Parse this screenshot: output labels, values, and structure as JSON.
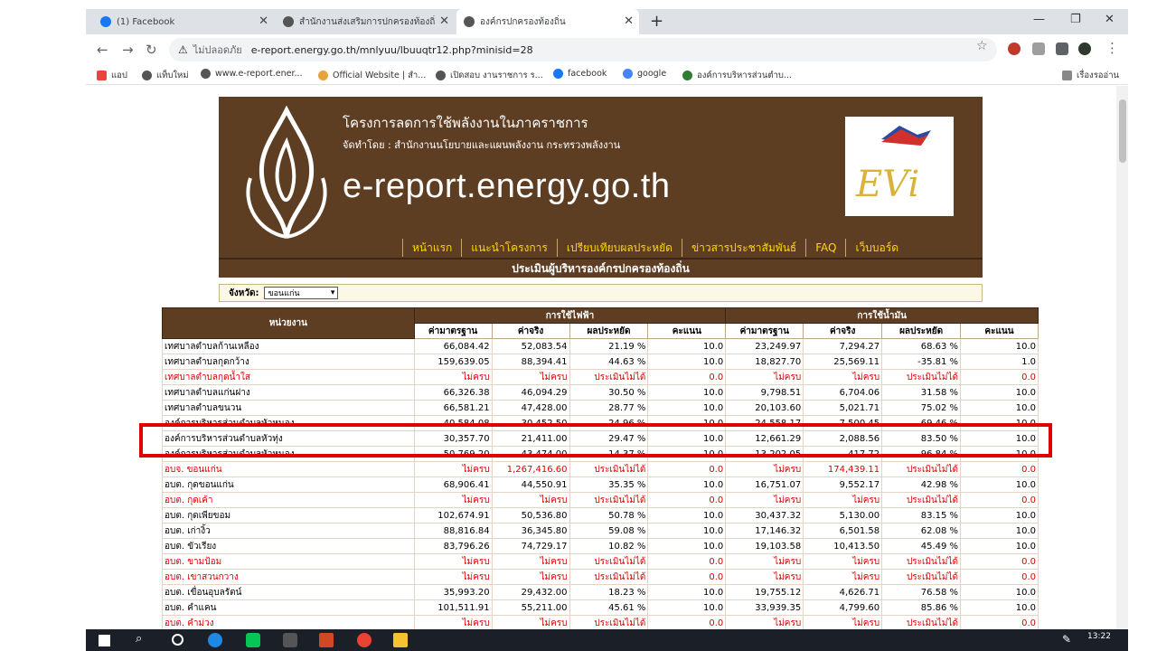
{
  "tabs": [
    {
      "label": "(1) Facebook",
      "color": "#1877f2"
    },
    {
      "label": "สำนักงานส่งเสริมการปกครองท้องถิ่นจั...",
      "color": "#555555"
    },
    {
      "label": "องค์กรปกครองท้องถิ่น",
      "color": "#555555"
    }
  ],
  "address": {
    "security": "ไม่ปลอดภัย",
    "url": "e-report.energy.go.th/mnlyuu/lbuuqtr12.php?minisid=28"
  },
  "bookmarks": [
    {
      "label": "แอป",
      "color": "#e8453c"
    },
    {
      "label": "แท็บใหม่",
      "color": "#555555"
    },
    {
      "label": "www.e-report.ener...",
      "color": "#555555"
    },
    {
      "label": "Official Website | สำ...",
      "color": "#e8a23c"
    },
    {
      "label": "เปิดสอบ งานราชการ ร...",
      "color": "#555555"
    },
    {
      "label": "facebook",
      "color": "#1877f2"
    },
    {
      "label": "google",
      "color": "#4285f4"
    },
    {
      "label": "องค์การบริหารส่วนตำบ...",
      "color": "#2e7d32"
    }
  ],
  "reading_list": "เรื่องรออ่าน",
  "banner": {
    "title": "โครงการลดการใช้พลังงานในภาคราชการ",
    "subtitle": "จัดทำโดย : สำนักงานนโยบายและแผนพลังงาน กระทรวงพลังงาน",
    "domain": "e-report.energy.go.th",
    "logo_text": "EVi",
    "menu": [
      "หน้าแรก",
      "แนะนำโครงการ",
      "เปรียบเทียบผลประหยัด",
      "ข่าวสารประชาสัมพันธ์",
      "FAQ",
      "เว็บบอร์ด"
    ]
  },
  "page_title": "ประเมินผู้บริหารองค์กรปกครองท้องถิ่น",
  "filter": {
    "label": "จังหวัด:",
    "value": "ขอนแก่น"
  },
  "table": {
    "unit_header": "หน่วยงาน",
    "group_electric": "การใช้ไฟฟ้า",
    "group_oil": "การใช้น้ำมัน",
    "sub_headers": [
      "ค่ามาตรฐาน",
      "ค่าจริง",
      "ผลประหยัด",
      "คะแนน",
      "ค่ามาตรฐาน",
      "ค่าจริง",
      "ผลประหยัด",
      "คะแนน"
    ],
    "rows": [
      {
        "name": "เทศบาลตำบลก้านเหลือง",
        "cells": [
          "66,084.42",
          "52,083.54",
          "21.19 %",
          "10.0",
          "23,249.97",
          "7,294.27",
          "68.63 %",
          "10.0"
        ],
        "red": false
      },
      {
        "name": "เทศบาลตำบลกุดกว้าง",
        "cells": [
          "159,639.05",
          "88,394.41",
          "44.63 %",
          "10.0",
          "18,827.70",
          "25,569.11",
          "-35.81 %",
          "1.0"
        ],
        "red": false
      },
      {
        "name": "เทศบาลตำบลกุดน้ำใส",
        "cells": [
          "ไม่ครบ",
          "ไม่ครบ",
          "ประเมินไม่ได้",
          "0.0",
          "ไม่ครบ",
          "ไม่ครบ",
          "ประเมินไม่ได้",
          "0.0"
        ],
        "red": true
      },
      {
        "name": "เทศบาลตำบลแก่นฝาง",
        "cells": [
          "66,326.38",
          "46,094.29",
          "30.50 %",
          "10.0",
          "9,798.51",
          "6,704.06",
          "31.58 %",
          "10.0"
        ],
        "red": false
      },
      {
        "name": "เทศบาลตำบลขนวน",
        "cells": [
          "66,581.21",
          "47,428.00",
          "28.77 %",
          "10.0",
          "20,103.60",
          "5,021.71",
          "75.02 %",
          "10.0"
        ],
        "red": false
      },
      {
        "name": "องค์การบริหารส่วนตำบลหัวหนอง",
        "cells": [
          "40,584.08",
          "30,452.50",
          "24.96 %",
          "10.0",
          "24,558.17",
          "7,500.45",
          "69.46 %",
          "10.0"
        ],
        "red": false
      },
      {
        "name": "องค์การบริหารส่วนตำบลหัวทุ่ง",
        "cells": [
          "30,357.70",
          "21,411.00",
          "29.47 %",
          "10.0",
          "12,661.29",
          "2,088.56",
          "83.50 %",
          "10.0"
        ],
        "red": false
      },
      {
        "name": "องค์การบริหารส่วนตำบลหัวหนอง",
        "cells": [
          "50,769.20",
          "43,474.00",
          "14.37 %",
          "10.0",
          "13,202.05",
          "417.72",
          "96.84 %",
          "10.0"
        ],
        "red": false
      },
      {
        "name": "อบจ. ขอนแก่น",
        "cells": [
          "ไม่ครบ",
          "1,267,416.60",
          "ประเมินไม่ได้",
          "0.0",
          "ไม่ครบ",
          "174,439.11",
          "ประเมินไม่ได้",
          "0.0"
        ],
        "red": true
      },
      {
        "name": "อบต. กุดขอนแก่น",
        "cells": [
          "68,906.41",
          "44,550.91",
          "35.35 %",
          "10.0",
          "16,751.07",
          "9,552.17",
          "42.98 %",
          "10.0"
        ],
        "red": false
      },
      {
        "name": "อบต. กุดเค้า",
        "cells": [
          "ไม่ครบ",
          "ไม่ครบ",
          "ประเมินไม่ได้",
          "0.0",
          "ไม่ครบ",
          "ไม่ครบ",
          "ประเมินไม่ได้",
          "0.0"
        ],
        "red": true
      },
      {
        "name": "อบต. กุดเพียขอม",
        "cells": [
          "102,674.91",
          "50,536.80",
          "50.78 %",
          "10.0",
          "30,437.32",
          "5,130.00",
          "83.15 %",
          "10.0"
        ],
        "red": false
      },
      {
        "name": "อบต. เก่างิ้ว",
        "cells": [
          "88,816.84",
          "36,345.80",
          "59.08 %",
          "10.0",
          "17,146.32",
          "6,501.58",
          "62.08 %",
          "10.0"
        ],
        "red": false
      },
      {
        "name": "อบต. ขัวเรียง",
        "cells": [
          "83,796.26",
          "74,729.17",
          "10.82 %",
          "10.0",
          "19,103.58",
          "10,413.50",
          "45.49 %",
          "10.0"
        ],
        "red": false
      },
      {
        "name": "อบต. ขามป้อม",
        "cells": [
          "ไม่ครบ",
          "ไม่ครบ",
          "ประเมินไม่ได้",
          "0.0",
          "ไม่ครบ",
          "ไม่ครบ",
          "ประเมินไม่ได้",
          "0.0"
        ],
        "red": true
      },
      {
        "name": "อบต. เขาสวนกวาง",
        "cells": [
          "ไม่ครบ",
          "ไม่ครบ",
          "ประเมินไม่ได้",
          "0.0",
          "ไม่ครบ",
          "ไม่ครบ",
          "ประเมินไม่ได้",
          "0.0"
        ],
        "red": true
      },
      {
        "name": "อบต. เขื่อนอุบลรัตน์",
        "cells": [
          "35,993.20",
          "29,432.00",
          "18.23 %",
          "10.0",
          "19,755.12",
          "4,626.71",
          "76.58 %",
          "10.0"
        ],
        "red": false
      },
      {
        "name": "อบต. คำแคน",
        "cells": [
          "101,511.91",
          "55,211.00",
          "45.61 %",
          "10.0",
          "33,939.35",
          "4,799.60",
          "85.86 %",
          "10.0"
        ],
        "red": false
      },
      {
        "name": "อบต. คำม่วง",
        "cells": [
          "ไม่ครบ",
          "ไม่ครบ",
          "ประเมินไม่ได้",
          "0.0",
          "ไม่ครบ",
          "ไม่ครบ",
          "ประเมินไม่ได้",
          "0.0"
        ],
        "red": true
      }
    ]
  },
  "taskbar": {
    "time": "13:22"
  }
}
